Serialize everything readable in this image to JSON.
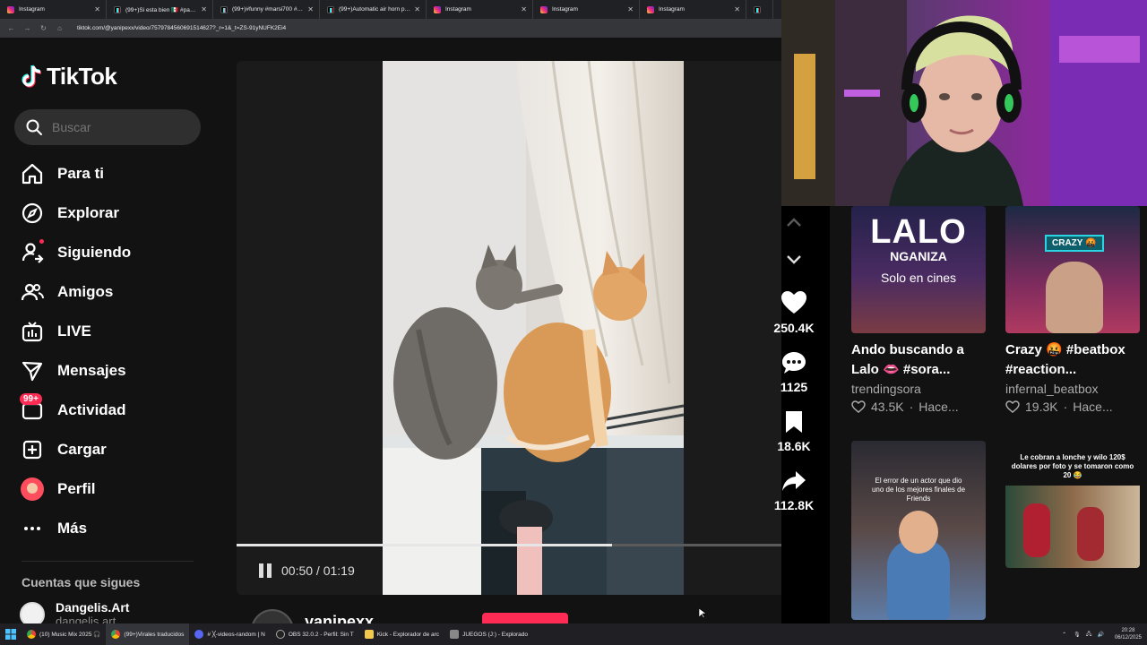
{
  "browser": {
    "tabs": [
      {
        "label": "Instagram",
        "icon": "instagram-icon"
      },
      {
        "label": "(99+)Si esta bien 🇲🇽 #parati #",
        "icon": "tiktok-icon"
      },
      {
        "label": "(99+)#funny #marsi700 #viral",
        "icon": "tiktok-icon"
      },
      {
        "label": "(99+)Automatic air horn prank",
        "icon": "tiktok-icon"
      },
      {
        "label": "Instagram",
        "icon": "instagram-icon"
      },
      {
        "label": "Instagram",
        "icon": "instagram-icon"
      },
      {
        "label": "Instagram",
        "icon": "instagram-icon"
      }
    ],
    "url": "tiktok.com/@yanipexx/video/7579784560691514627?_r=1&_t=ZS-91yNUFK2Ei4"
  },
  "tiktok": {
    "logo_text": "TikTok",
    "search_placeholder": "Buscar",
    "nav": [
      {
        "label": "Para ti",
        "icon": "home-icon"
      },
      {
        "label": "Explorar",
        "icon": "compass-icon"
      },
      {
        "label": "Siguiendo",
        "icon": "following-icon"
      },
      {
        "label": "Amigos",
        "icon": "friends-icon"
      },
      {
        "label": "LIVE",
        "icon": "live-icon"
      },
      {
        "label": "Mensajes",
        "icon": "messages-icon"
      },
      {
        "label": "Actividad",
        "icon": "activity-icon",
        "badge": "99+"
      },
      {
        "label": "Cargar",
        "icon": "upload-icon"
      },
      {
        "label": "Perfil",
        "icon": "profile-avatar"
      },
      {
        "label": "Más",
        "icon": "more-icon"
      }
    ],
    "following_title": "Cuentas que sigues",
    "following": [
      {
        "name": "Dangelis.Art",
        "handle": "dangelis.art"
      }
    ]
  },
  "player": {
    "current_time": "00:50",
    "duration": "01:19",
    "time_display": "00:50 / 01:19",
    "progress": 0.633,
    "creator": "yanipexx"
  },
  "actions": {
    "likes": "250.4K",
    "comments": "1125",
    "saves": "18.6K",
    "shares": "112.8K"
  },
  "recommendations": [
    {
      "thumb_title": "LALO",
      "thumb_sub": "NGANIZA",
      "thumb_caption": "Solo en cines",
      "title_line1": "Ando buscando a",
      "title_line2": "Lalo 👄 #sora...",
      "author": "trendingsora",
      "likes": "43.5K",
      "time": "Hace..."
    },
    {
      "thumb_badge": "CRAZY 🤬",
      "title_line1": "Crazy 🤬 #beatbox",
      "title_line2": "#reaction...",
      "author": "infernal_beatbox",
      "likes": "19.3K",
      "time": "Hace..."
    },
    {
      "thumb_caption": "El error de un actor que dio uno de los mejores finales de Friends"
    },
    {
      "thumb_caption": "Le cobran a lonche y wilo 120$ dolares por foto y se tomaron como 20 😂"
    }
  ],
  "taskbar": {
    "items": [
      {
        "label": "(10) Music Mix 2025 🎧",
        "color": "#e8453c"
      },
      {
        "label": "(99+)Virales traducidos",
        "color": "#e8453c"
      },
      {
        "label": "# ╳-videos-random | N",
        "color": "#5865f2"
      },
      {
        "label": "OBS 32.0.2 - Perfil: Sin T",
        "color": "#444"
      },
      {
        "label": "Kick - Explorador de arc",
        "color": "#f2c94c"
      },
      {
        "label": "JUEGOS (J:) - Explorado",
        "color": "#888"
      }
    ],
    "time": "20:28",
    "date": "06/12/2025"
  },
  "colors": {
    "accent": "#fe2c55",
    "background": "#121212"
  }
}
